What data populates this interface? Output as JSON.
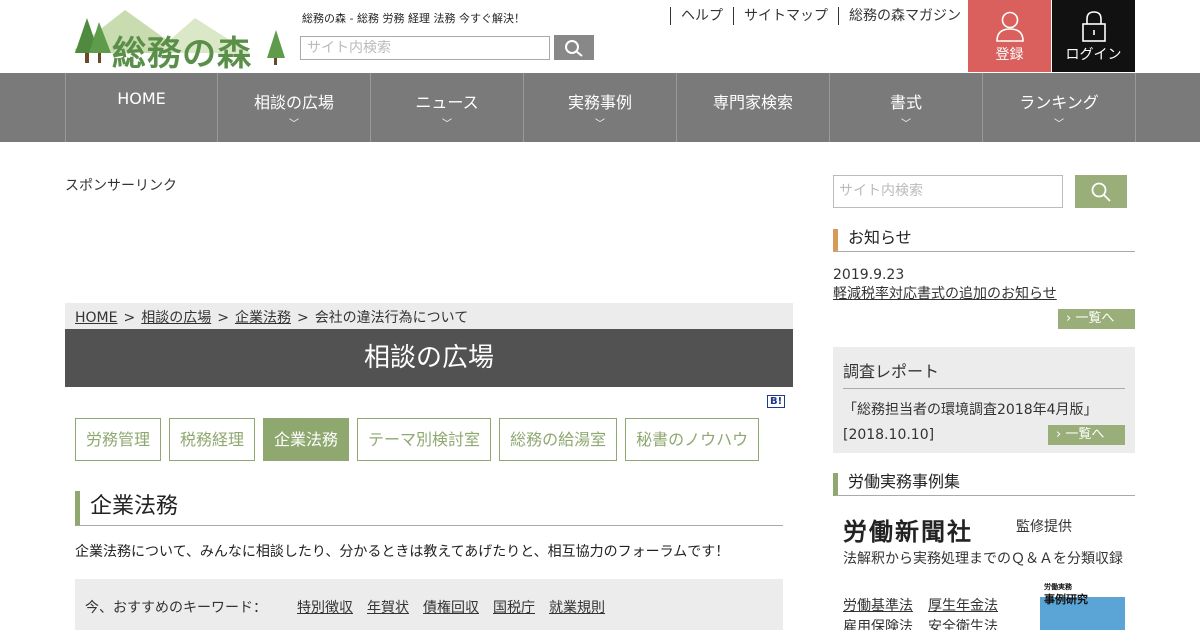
{
  "header": {
    "logo_text": "総務の森",
    "tagline": "総務の森 - 総務 労務 経理 法務 今すぐ解決！",
    "search_placeholder": "サイト内検索",
    "top_links": [
      "ヘルプ",
      "サイトマップ",
      "総務の森マガジン"
    ],
    "register_label": "登録",
    "login_label": "ログイン"
  },
  "nav": {
    "items": [
      {
        "label": "HOME",
        "has_dropdown": false
      },
      {
        "label": "相談の広場",
        "has_dropdown": true
      },
      {
        "label": "ニュース",
        "has_dropdown": true
      },
      {
        "label": "実務事例",
        "has_dropdown": true
      },
      {
        "label": "専門家検索",
        "has_dropdown": false
      },
      {
        "label": "書式",
        "has_dropdown": true
      },
      {
        "label": "ランキング",
        "has_dropdown": true
      }
    ],
    "chevron": "﹀"
  },
  "main": {
    "sponsor_label": "スポンサーリンク",
    "breadcrumb": {
      "items": [
        "HOME",
        "相談の広場",
        "企業法務"
      ],
      "current": "会社の違法行為について",
      "separator": ">"
    },
    "banner_title": "相談の広場",
    "bi_badge": "B!",
    "tabs": [
      {
        "label": "労務管理",
        "active": false
      },
      {
        "label": "税務経理",
        "active": false
      },
      {
        "label": "企業法務",
        "active": true
      },
      {
        "label": "テーマ別検討室",
        "active": false
      },
      {
        "label": "総務の給湯室",
        "active": false
      },
      {
        "label": "秘書のノウハウ",
        "active": false
      }
    ],
    "section_heading": "企業法務",
    "section_desc": "企業法務について、みんなに相談したり、分かるときは教えてあげたりと、相互協力のフォーラムです！",
    "keywords_label": "今、おすすめのキーワード：",
    "keywords": [
      "特別徴収",
      "年賀状",
      "債権回収",
      "国税庁",
      "就業規則"
    ]
  },
  "sidebar": {
    "search_placeholder": "サイト内検索",
    "notice_heading": "お知らせ",
    "notice_date": "2019.9.23",
    "notice_link": "軽減税率対応書式の追加のお知らせ",
    "more_label": "一覧へ",
    "survey_heading": "調査レポート",
    "survey_item": "「総務担当者の環境調査2018年4月版」",
    "survey_date": "[2018.10.10]",
    "casebook_heading": "労働実務事例集",
    "publisher_logo": "労働新聞社",
    "publisher_sup": "監修提供",
    "casebook_desc": "法解釈から実務処理までのＱ＆Ａを分類収録",
    "law_links": [
      "労働基準法",
      "厚生年金法",
      "雇用保険法",
      "安全衛生法"
    ],
    "book_small": "労働実務",
    "book_title": "事例研究"
  },
  "colors": {
    "nav_bg": "#7a7a7a",
    "accent_green": "#8fa870",
    "register_bg": "#d9605c",
    "login_bg": "#111111",
    "banner_bg": "#525252",
    "notice_accent": "#d89a5a"
  }
}
